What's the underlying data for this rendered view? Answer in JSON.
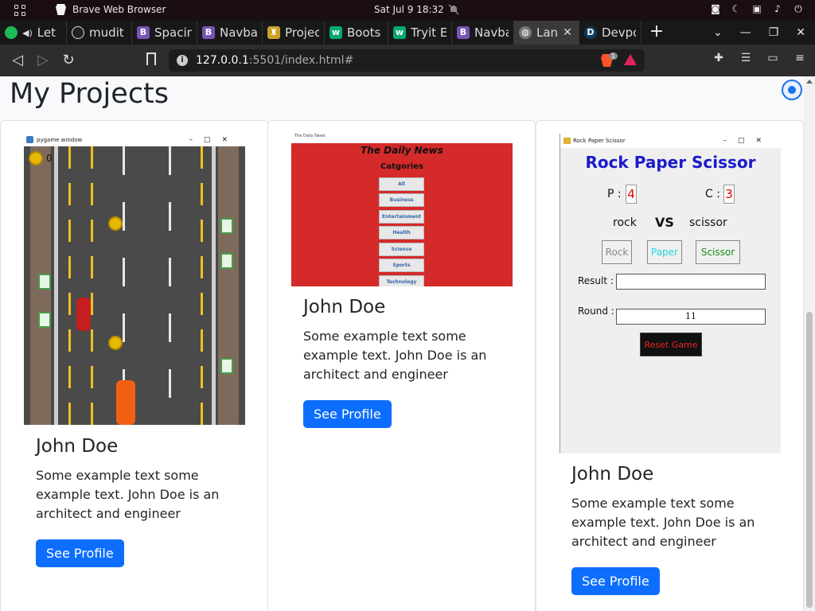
{
  "os": {
    "app_title": "Brave Web Browser",
    "clock": "Sat Jul 9  18:32"
  },
  "tabs": [
    {
      "label": "Let",
      "fav_color": "#1db954",
      "fav_glyph": "●",
      "audio": true
    },
    {
      "label": "mudit",
      "fav_color": "#222222",
      "fav_glyph": "◉"
    },
    {
      "label": "Spacin",
      "fav_color": "#7952b3",
      "fav_glyph": "B"
    },
    {
      "label": "Navba",
      "fav_color": "#7952b3",
      "fav_glyph": "B"
    },
    {
      "label": "Projec",
      "fav_color": "#c9a227",
      "fav_glyph": "♜"
    },
    {
      "label": "Boots",
      "fav_color": "#04aa6d",
      "fav_glyph": "w"
    },
    {
      "label": "Tryit E",
      "fav_color": "#04aa6d",
      "fav_glyph": "w"
    },
    {
      "label": "Navba",
      "fav_color": "#7952b3",
      "fav_glyph": "B"
    },
    {
      "label": "Lan",
      "fav_color": "#666666",
      "fav_glyph": "◍",
      "active": true
    },
    {
      "label": "Devpo",
      "fav_color": "#0e3b5c",
      "fav_glyph": "D"
    }
  ],
  "address": {
    "host": "127.0.0.1",
    "rest": ":5501/index.html#",
    "shield_count": "1"
  },
  "page": {
    "heading": "My Projects"
  },
  "cards": [
    {
      "title": "John Doe",
      "text": "Some example text some example text. John Doe is an architect and engineer",
      "button": "See Profile",
      "shot": {
        "window_title": "pygame window",
        "coin_count": "0"
      }
    },
    {
      "title": "John Doe",
      "text": "Some example text some example text. John Doe is an architect and engineer",
      "button": "See Profile",
      "shot": {
        "window_title": "The Daily News",
        "heading": "The Daily News",
        "subheading": "Catgories",
        "categories": [
          "All",
          "Business",
          "Entertainment",
          "Health",
          "Science",
          "Sports",
          "Technology"
        ]
      }
    },
    {
      "title": "John Doe",
      "text": "Some example text some example text. John Doe is an architect and engineer",
      "button": "See Profile",
      "shot": {
        "window_title": "Rock Paper Scissor",
        "heading": "Rock Paper Scissor",
        "p_label": "P :",
        "p_score": "4",
        "c_label": "C :",
        "c_score": "3",
        "player_choice": "rock",
        "vs": "VS",
        "computer_choice": "scissor",
        "buttons": [
          "Rock",
          "Paper",
          "Scissor"
        ],
        "result_label": "Result :",
        "result_value": "",
        "round_label": "Round :",
        "round_value": "11",
        "reset_label": "Reset Game"
      }
    }
  ]
}
